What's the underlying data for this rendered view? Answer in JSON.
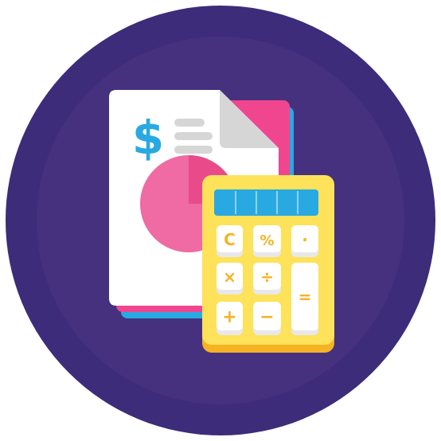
{
  "document": {
    "symbol": "$",
    "pie_values": [
      25,
      75
    ]
  },
  "calculator": {
    "display_segments": 5,
    "keys": {
      "clear": "C",
      "percent": "%",
      "dot": "·",
      "multiply": "×",
      "divide": "÷",
      "equals": "=",
      "plus": "+",
      "minus": "−"
    }
  },
  "colors": {
    "background_outer": "#3d2c7a",
    "background_inner": "#46317f",
    "paper": "#ffffff",
    "paper_shadow": "#e6e6ea",
    "page_pink": "#f0468f",
    "page_blue": "#29a9e1",
    "pie_main": "#f06aa3",
    "pie_slice": "#e94b8a",
    "dollar": "#29a9e1",
    "text_lines": "#d6d6d6",
    "calculator_body": "#fde25a",
    "calculator_edge": "#f5b324",
    "display": "#29a9e1",
    "key": "#ffffff",
    "key_shadow": "#e8e8ea"
  }
}
